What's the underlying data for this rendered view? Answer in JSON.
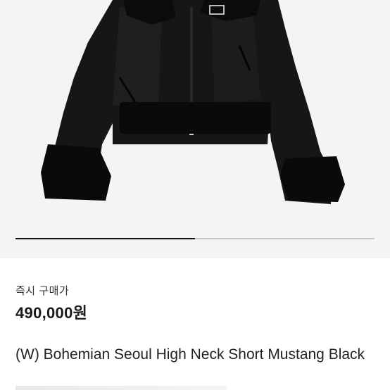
{
  "product": {
    "image_subject": "black shearling cropped jacket",
    "image_progress_fraction": 0.5,
    "price_label": "즉시 구매가",
    "price": "490,000원",
    "title": "(W) Bohemian Seoul High Neck Short Mustang Black"
  },
  "colors": {
    "background": "#ffffff",
    "image_bg": "#f4f4f4",
    "jacket": "#141414",
    "progress_active": "#111111",
    "progress_track": "#c7c7c7"
  }
}
